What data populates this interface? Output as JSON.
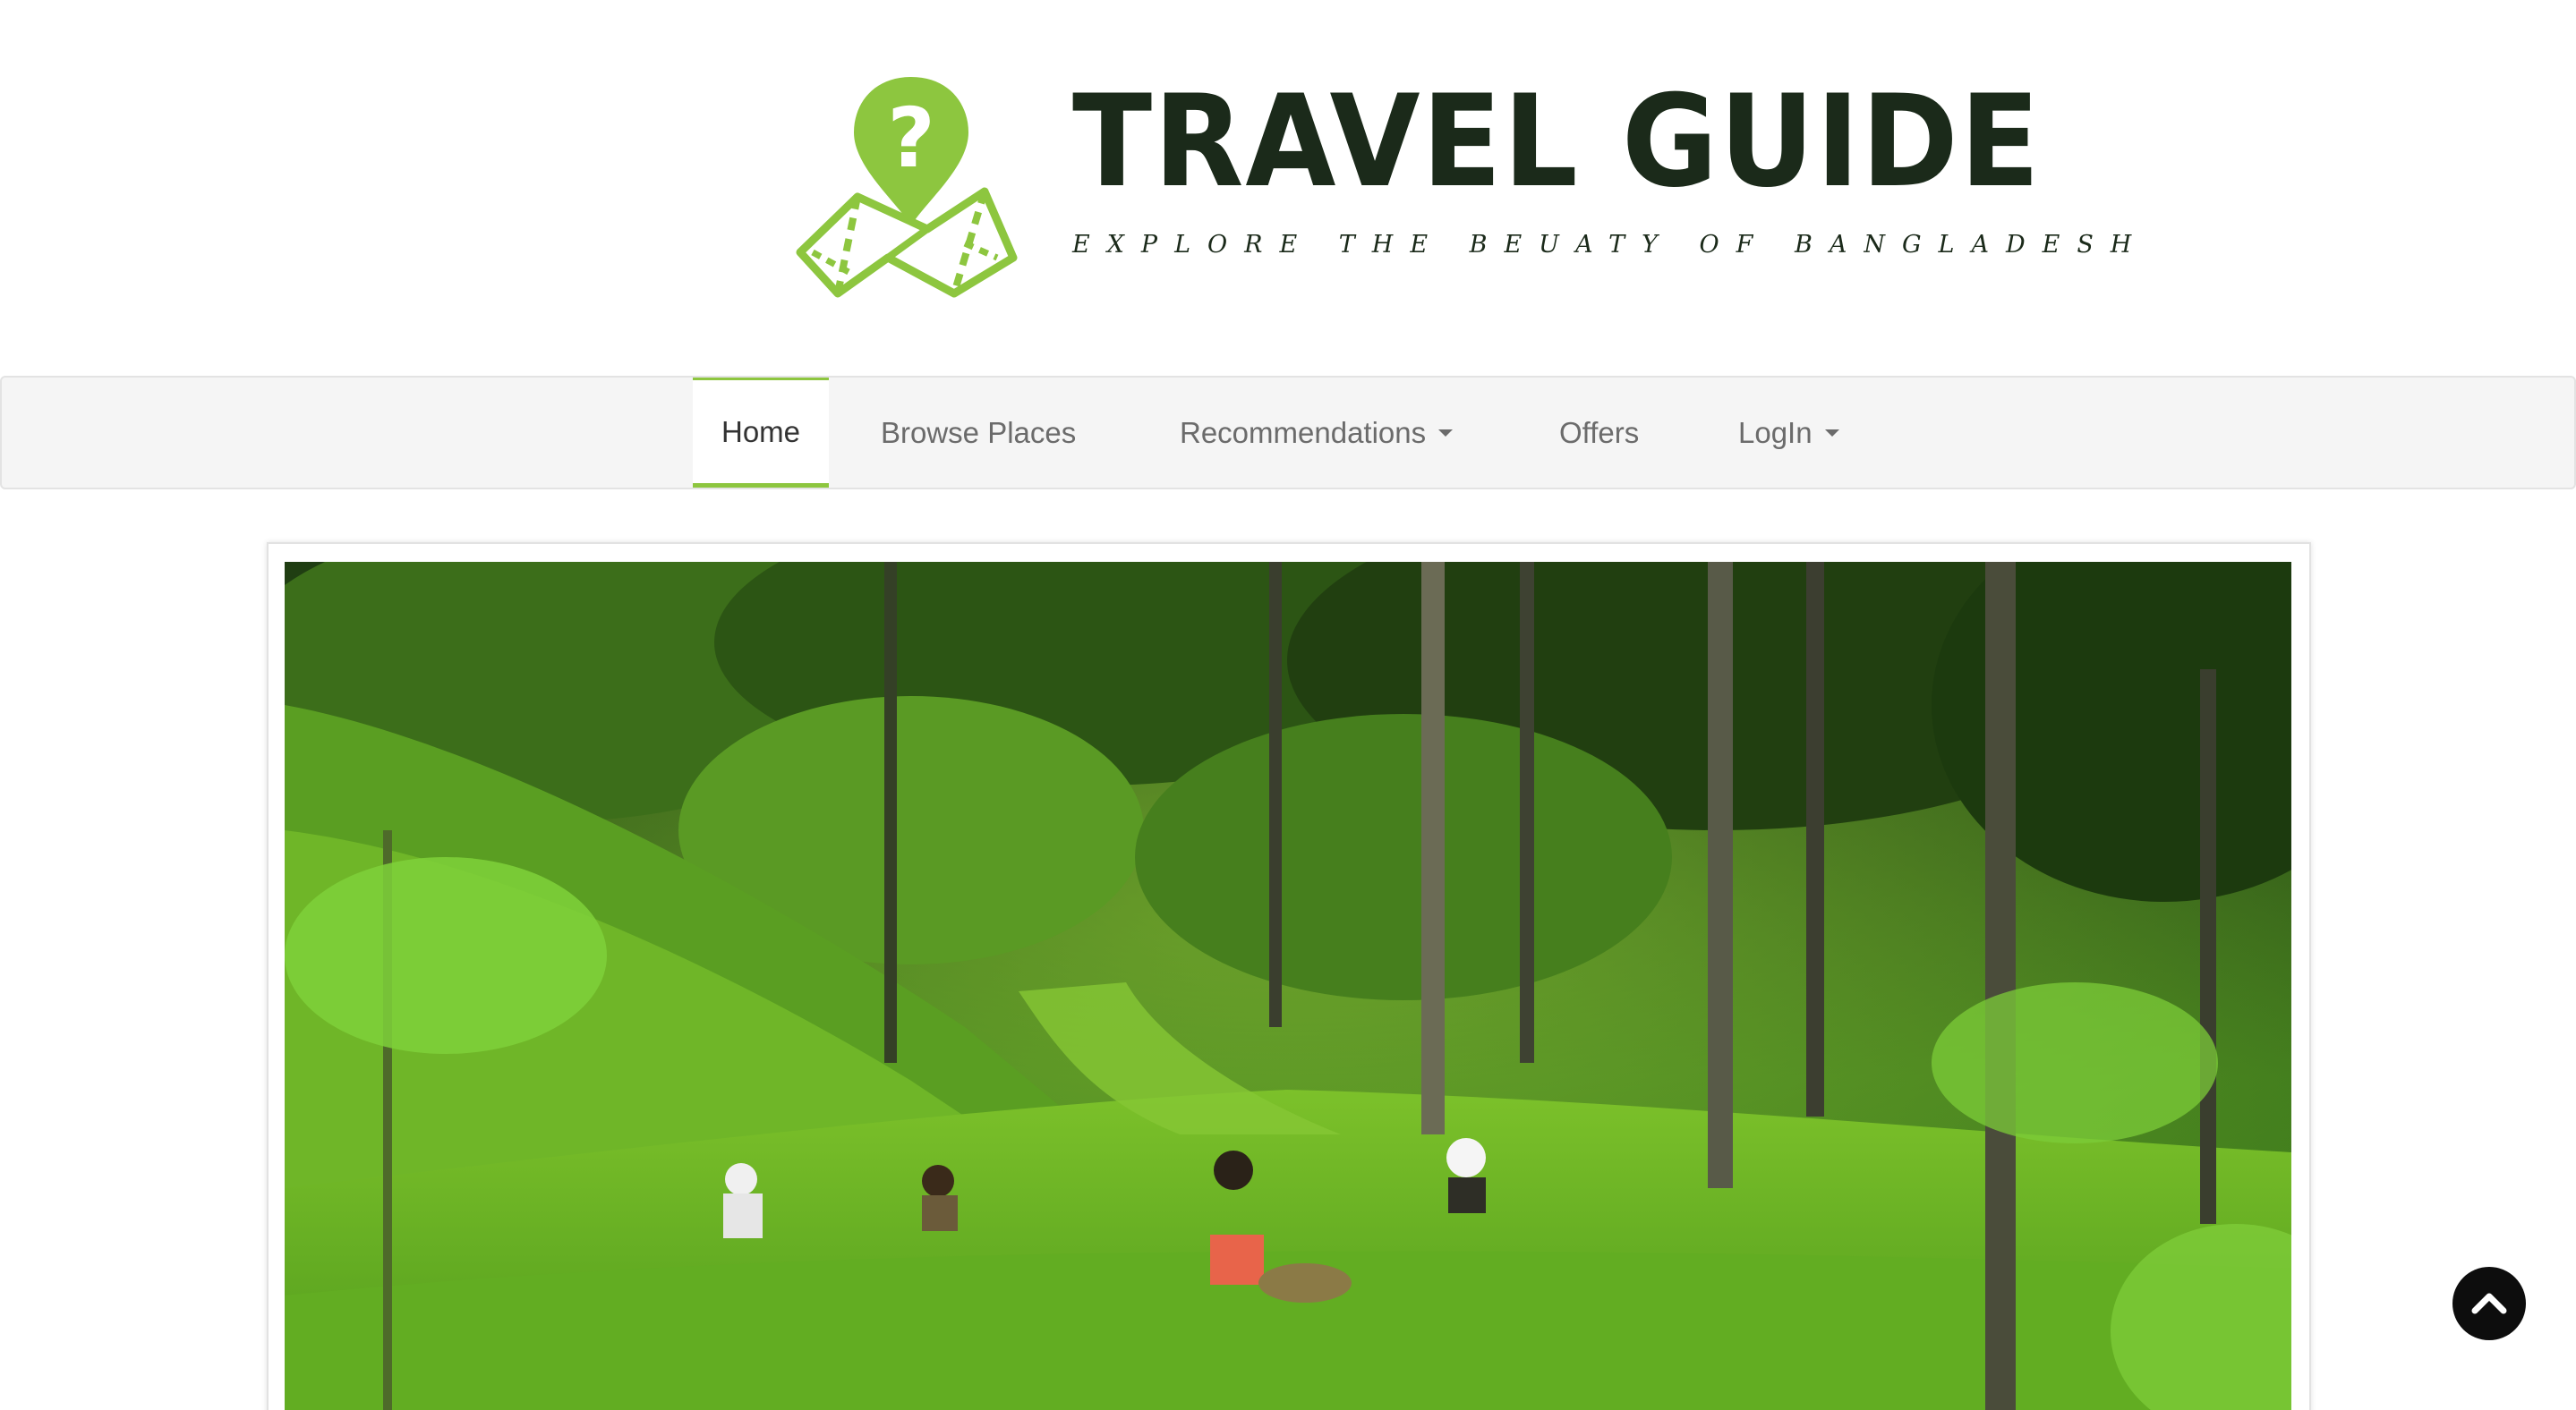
{
  "brand": {
    "title": "TRAVEL GUIDE",
    "tagline": "EXPLORE THE BEUATY OF BANGLADESH",
    "icon": "map-pin-question-icon",
    "accent_color": "#8dc63f",
    "text_color": "#1b2a1a"
  },
  "nav": {
    "items": [
      {
        "label": "Home",
        "active": true,
        "dropdown": false
      },
      {
        "label": "Browse Places",
        "active": false,
        "dropdown": false
      },
      {
        "label": "Recommendations",
        "active": false,
        "dropdown": true
      },
      {
        "label": "Offers",
        "active": false,
        "dropdown": false
      },
      {
        "label": "LogIn",
        "active": false,
        "dropdown": true
      }
    ]
  },
  "hero": {
    "image_subject": "tea garden with tea pickers"
  },
  "back_to_top": {
    "icon": "chevron-up-icon"
  }
}
